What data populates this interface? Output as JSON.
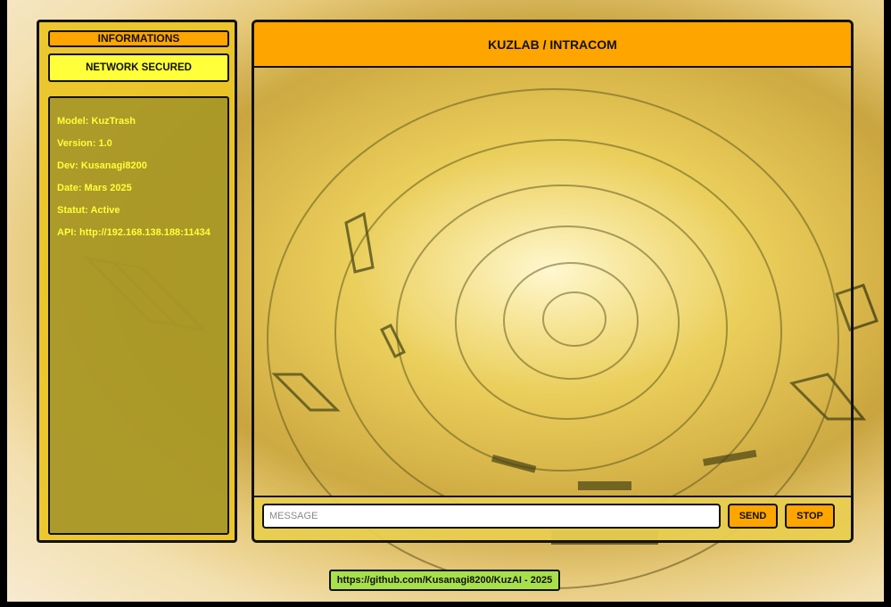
{
  "sidebar": {
    "title": "INFORMATIONS",
    "status": "NETWORK SECURED",
    "details": [
      "Model: KuzTrash",
      "Version: 1.0",
      "Dev: Kusanagi8200",
      "Date: Mars 2025",
      "Statut: Active",
      "API: http://192.168.138.188:11434"
    ]
  },
  "chat": {
    "title": "KUZLAB / INTRACOM",
    "input_placeholder": "MESSAGE",
    "send_label": "SEND",
    "stop_label": "STOP"
  },
  "footer": {
    "link_text": "https://github.com/Kusanagi8200/KuzAI - 2025"
  },
  "colors": {
    "accent": "#ffa500",
    "status": "#ffff3a",
    "panel": "#eac424",
    "footer": "#a8e04a"
  }
}
